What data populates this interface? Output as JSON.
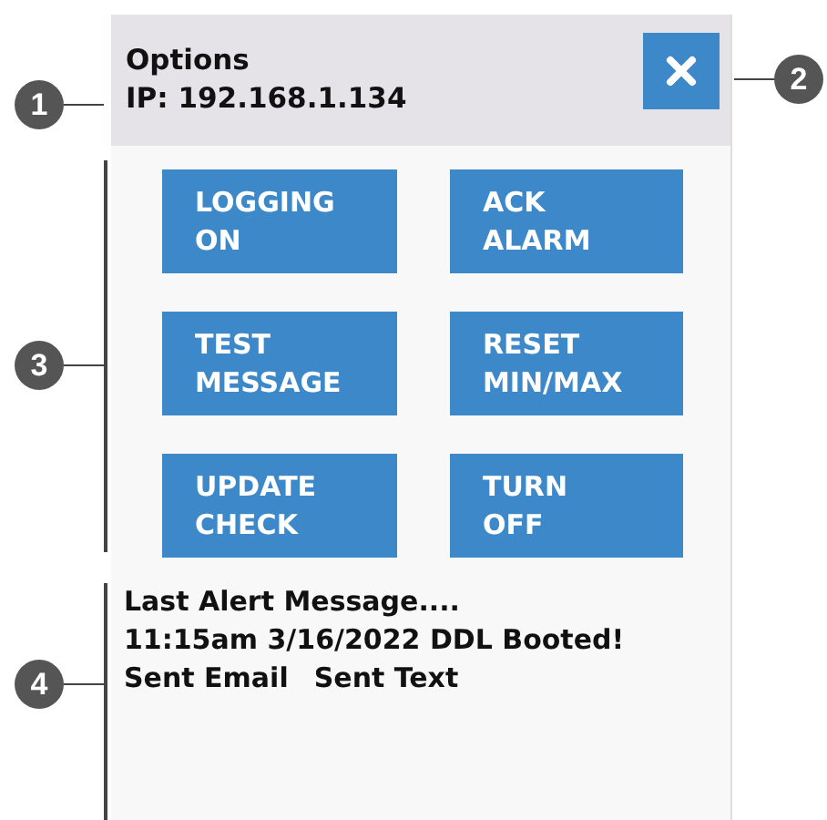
{
  "header": {
    "title": "Options",
    "ip": "IP: 192.168.1.134"
  },
  "buttons": [
    {
      "label": "LOGGING\nON"
    },
    {
      "label": "ACK\nALARM"
    },
    {
      "label": "TEST\nMESSAGE"
    },
    {
      "label": "RESET\nMIN/MAX"
    },
    {
      "label": "UPDATE\nCHECK"
    },
    {
      "label": "TURN\nOFF"
    }
  ],
  "message": {
    "heading": "Last Alert Message....",
    "detail": "11:15am 3/16/2022 DDL Booted!",
    "statuses": [
      "Sent Email",
      "Sent Text"
    ]
  },
  "left_callouts": [
    {
      "number": "1"
    },
    {
      "number": "3"
    },
    {
      "number": "4"
    }
  ],
  "right_callouts": [
    {
      "number": "2"
    }
  ]
}
